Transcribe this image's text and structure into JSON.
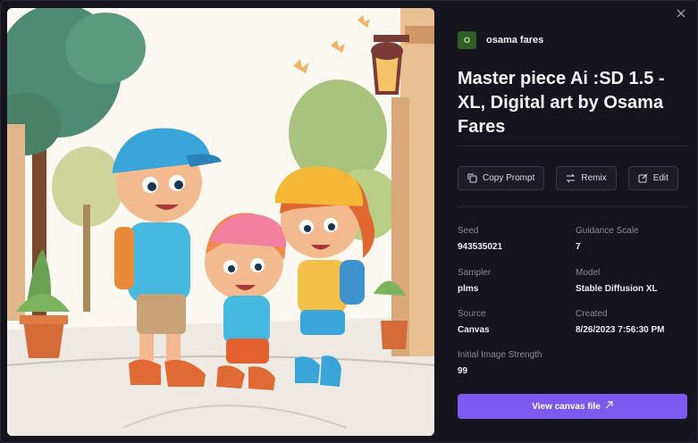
{
  "author": {
    "initial": "O",
    "name": "osama fares"
  },
  "title": "Master piece Ai :SD 1.5 - XL, Digital art by Osama Fares",
  "actions": {
    "copy_prompt": "Copy Prompt",
    "remix": "Remix",
    "edit": "Edit"
  },
  "details": {
    "seed_label": "Seed",
    "seed_value": "943535021",
    "guidance_label": "Guidance Scale",
    "guidance_value": "7",
    "sampler_label": "Sampler",
    "sampler_value": "plms",
    "model_label": "Model",
    "model_value": "Stable Diffusion XL",
    "source_label": "Source",
    "source_value": "Canvas",
    "created_label": "Created",
    "created_value": "8/26/2023 7:56:30 PM",
    "strength_label": "Initial Image Strength",
    "strength_value": "99"
  },
  "canvas_button": "View canvas file",
  "colors": {
    "background": "#16151e",
    "accent": "#7b5af0",
    "avatar": "#2f5f25",
    "muted_text": "#8a8996"
  },
  "icons": [
    "close-icon",
    "copy-icon",
    "remix-icon",
    "edit-icon",
    "external-link-icon"
  ]
}
